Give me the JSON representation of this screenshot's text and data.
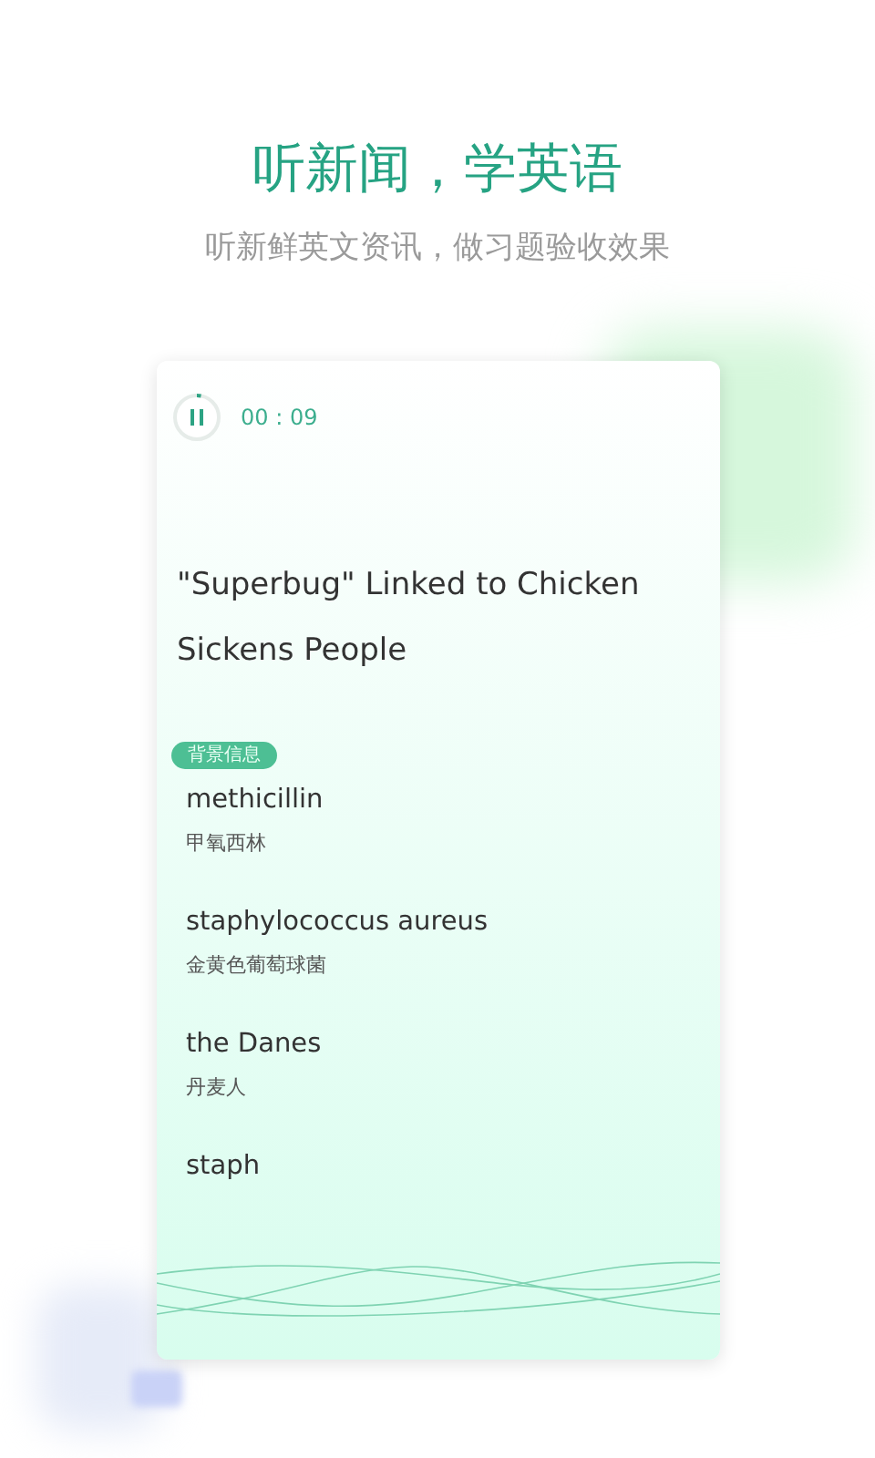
{
  "headline": "听新闻，学英语",
  "subtitle": "听新鲜英文资讯，做习题验收效果",
  "player": {
    "playing": true,
    "time": "00 : 09"
  },
  "article": {
    "title": "\"Superbug\" Linked to Chicken Sickens People",
    "tag": "背景信息",
    "terms": [
      {
        "word": "methicillin",
        "meaning": "甲氧西林"
      },
      {
        "word": "staphylococcus aureus",
        "meaning": "金黄色葡萄球菌"
      },
      {
        "word": "the Danes",
        "meaning": "丹麦人"
      },
      {
        "word": "staph"
      }
    ]
  }
}
